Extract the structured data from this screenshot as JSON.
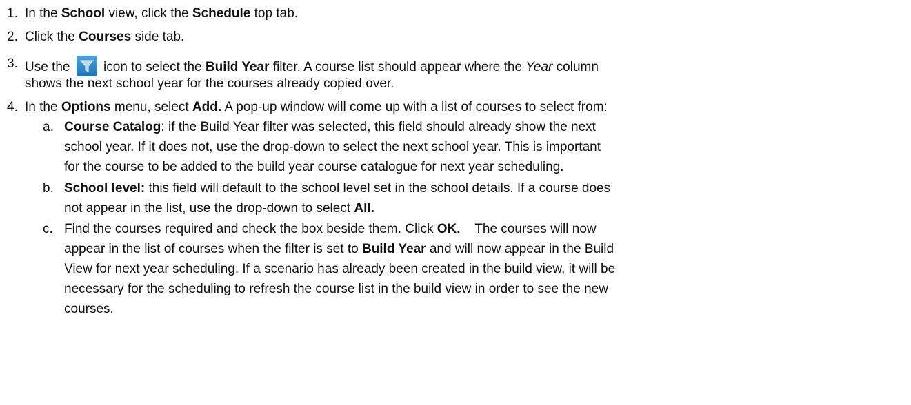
{
  "steps": [
    {
      "number": "1.",
      "parts": [
        "In the ",
        "School",
        " view, click the ",
        "Schedule",
        " top tab."
      ]
    },
    {
      "number": "2.",
      "parts": [
        "Click the ",
        "Courses",
        " side tab."
      ]
    },
    {
      "number": "3.",
      "line1_parts": [
        "Use the ",
        " icon to select the ",
        "Build Year",
        " filter.  A course list should appear where the ",
        "Year",
        " column"
      ],
      "line2": "shows the next school year for the courses already copied over."
    },
    {
      "number": "4.",
      "parts": [
        "In the ",
        "Options",
        " menu, select ",
        "Add.",
        "  A pop-up window will come up with a list of courses to select from:"
      ]
    }
  ],
  "substeps": [
    {
      "letter": "a.",
      "lines": [
        [
          "",
          "Course Catalog",
          ":  if the Build Year filter was selected, this field should already show the next"
        ],
        "school year.  If it does not, use the drop-down to select the next school year.  This is important",
        "for the course to be added to the build year course catalogue for next year scheduling."
      ]
    },
    {
      "letter": "b.",
      "lines": [
        [
          "",
          "School level:",
          "  this field will default to the school level set in the school details.  If a course does"
        ],
        [
          "not appear in the list, use the drop-down to select ",
          "All.",
          ""
        ]
      ]
    },
    {
      "letter": "c.",
      "lines": [
        [
          "Find the courses required and check the box beside them.  Click ",
          "OK.",
          "    The courses will now"
        ],
        [
          "appear in the list of courses when the filter is set to ",
          "Build Year",
          " and will now appear in the Build"
        ],
        "View for next year scheduling.  If a scenario has already been created in the build view, it will be",
        "necessary for the scheduling to refresh the course list in the build view in order to see the new",
        "courses."
      ]
    }
  ],
  "icons": {
    "filter": "filter-funnel-icon"
  },
  "colors": {
    "icon_top": "#4aa6e0",
    "icon_bottom": "#1f74b9",
    "text": "#111111"
  }
}
